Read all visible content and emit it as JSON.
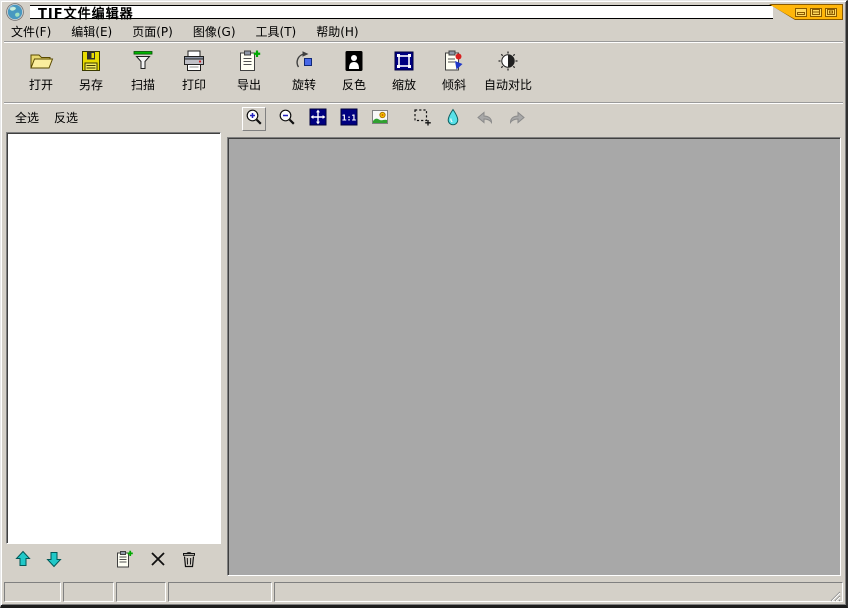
{
  "window": {
    "title": "TIF文件编辑器",
    "app_icon": "globe-icon",
    "controls": [
      {
        "icon": "minimize-icon",
        "name": "minimize"
      },
      {
        "icon": "maximize-icon",
        "name": "maximize"
      },
      {
        "icon": "restore-icon",
        "name": "restore"
      }
    ]
  },
  "menu": {
    "items": [
      {
        "label": "文件(F)"
      },
      {
        "label": "编辑(E)"
      },
      {
        "label": "页面(P)"
      },
      {
        "label": "图像(G)"
      },
      {
        "label": "工具(T)"
      },
      {
        "label": "帮助(H)"
      }
    ]
  },
  "toolbar": {
    "buttons": [
      {
        "icon": "open-folder-icon",
        "label": "打开"
      },
      {
        "icon": "save-floppy-icon",
        "label": "另存"
      },
      {
        "icon": "scan-icon",
        "label": "扫描"
      },
      {
        "icon": "print-icon",
        "label": "打印"
      },
      {
        "icon": "export-icon",
        "label": "导出"
      },
      {
        "icon": "rotate-icon",
        "label": "旋转"
      },
      {
        "icon": "invert-icon",
        "label": "反色"
      },
      {
        "icon": "scale-icon",
        "label": "缩放"
      },
      {
        "icon": "skew-icon",
        "label": "倾斜"
      },
      {
        "icon": "auto-contrast-icon",
        "label": "自动对比"
      }
    ]
  },
  "page_panel": {
    "select_all_label": "全选",
    "invert_selection_label": "反选",
    "pages": []
  },
  "view_toolbar": {
    "buttons": [
      {
        "icon": "zoom-in-icon",
        "active": true
      },
      {
        "icon": "zoom-out-icon"
      },
      {
        "icon": "fit-window-icon"
      },
      {
        "icon": "actual-size-icon",
        "label": "1:1"
      },
      {
        "icon": "image-view-icon"
      },
      {
        "icon": "select-region-icon"
      },
      {
        "icon": "fill-color-icon"
      },
      {
        "icon": "undo-icon",
        "disabled": true
      },
      {
        "icon": "redo-icon",
        "disabled": true
      }
    ]
  },
  "page_toolbar": {
    "buttons": [
      {
        "icon": "move-up-icon"
      },
      {
        "icon": "move-down-icon"
      },
      {
        "icon": "copy-page-icon"
      },
      {
        "icon": "delete-x-icon"
      },
      {
        "icon": "trash-icon"
      }
    ]
  },
  "status_bar": {
    "panels": [
      "",
      "",
      "",
      "",
      ""
    ]
  },
  "colors": {
    "chrome": "#d4d0c8",
    "canvas": "#a8a8a8",
    "titlebar_accent": "#ffb60a",
    "titlebar_accent_dark": "#8a5a00",
    "navy_icon": "#000080",
    "teal_arrow": "#20c8c8"
  }
}
